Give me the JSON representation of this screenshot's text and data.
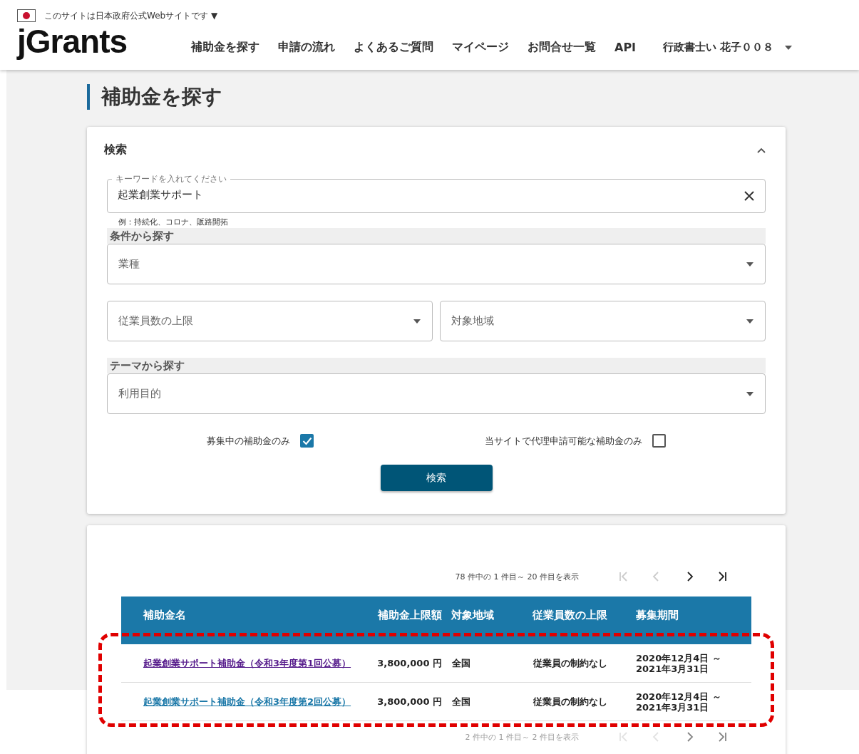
{
  "gov_banner": {
    "text": "このサイトは日本政府公式Webサイトです ▼"
  },
  "logo": {
    "text": "jGrants"
  },
  "nav": [
    {
      "label": "補助金を探す"
    },
    {
      "label": "申請の流れ"
    },
    {
      "label": "よくあるご質問"
    },
    {
      "label": "マイページ"
    },
    {
      "label": "お問合せ一覧"
    },
    {
      "label": "API"
    }
  ],
  "user_menu": {
    "label": "行政書士い 花子００８"
  },
  "page_title": "補助金を探す",
  "search_panel": {
    "title": "検索",
    "expanded": true,
    "keyword": {
      "label": "キーワードを入れてください",
      "value": "起業創業サポート",
      "hint": "例：持続化、コロナ、販路開拓"
    },
    "sections": [
      {
        "heading": "条件から探す",
        "rows": [
          [
            {
              "placeholder": "業種"
            }
          ],
          [
            {
              "placeholder": "従業員数の上限"
            },
            {
              "placeholder": "対象地域"
            }
          ]
        ]
      },
      {
        "heading": "テーマから探す",
        "rows": [
          [
            {
              "placeholder": "利用目的"
            }
          ]
        ]
      }
    ],
    "checkboxes": [
      {
        "label": "募集中の補助金のみ",
        "checked": true
      },
      {
        "label": "当サイトで代理申請可能な補助金のみ",
        "checked": false
      }
    ],
    "button": "検索"
  },
  "results": {
    "pager_top": {
      "text": "78 件中の 1 件目～ 20 件目を表示",
      "first_disabled": true,
      "prev_disabled": true,
      "next_disabled": false,
      "last_disabled": false
    },
    "columns": [
      "補助金名",
      "補助金上限額",
      "対象地域",
      "従業員数の上限",
      "募集期間"
    ],
    "rows": [
      {
        "name": "起業創業サポート補助金（令和3年度第1回公募）",
        "visited": true,
        "amount": "3,800,000 円",
        "region": "全国",
        "employees": "従業員の制約なし",
        "period": [
          "2020年12月4日 ～",
          "2021年3月31日"
        ]
      },
      {
        "name": "起業創業サポート補助金（令和3年度第2回公募）",
        "visited": false,
        "amount": "3,800,000 円",
        "region": "全国",
        "employees": "従業員の制約なし",
        "period": [
          "2020年12月4日 ～",
          "2021年3月31日"
        ]
      }
    ],
    "highlight": true,
    "pager_bottom": {
      "text": "2 件中の 1 件目～ 2 件目を表示",
      "first_disabled": true,
      "prev_disabled": true,
      "next_disabled": false,
      "last_disabled": false
    }
  }
}
